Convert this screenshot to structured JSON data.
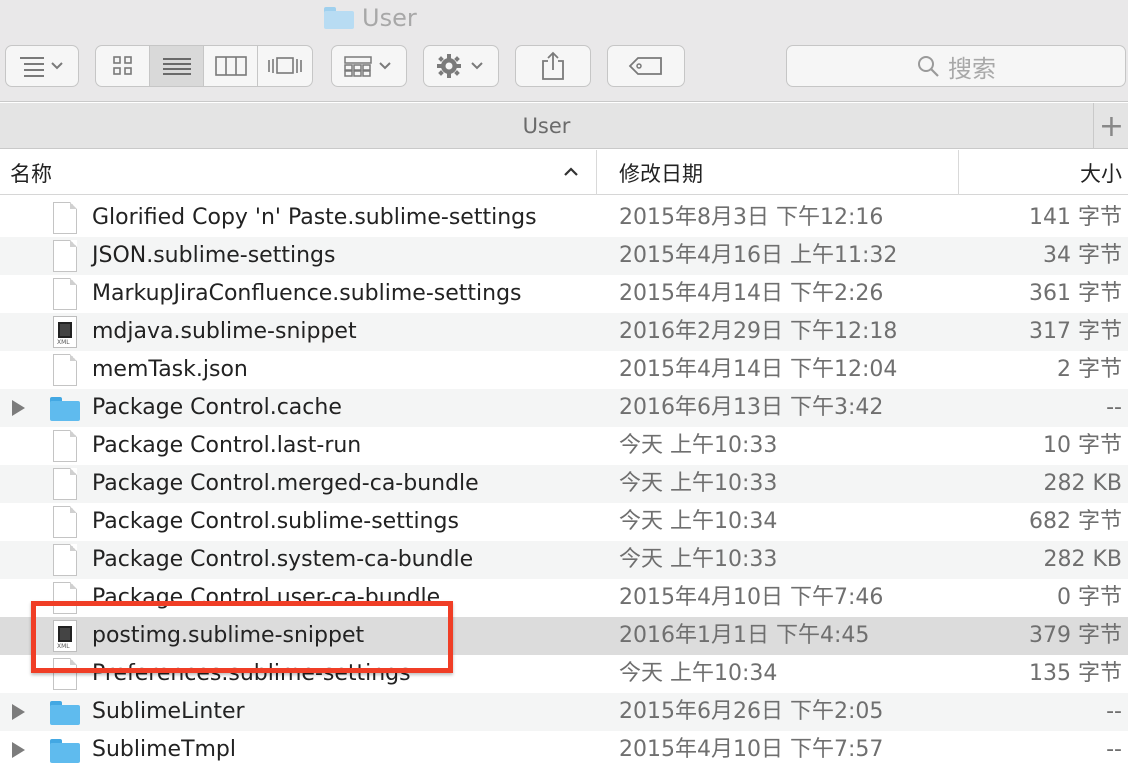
{
  "window": {
    "title": "User"
  },
  "toolbar": {
    "search_placeholder": "搜索"
  },
  "pathbar": {
    "current": "User",
    "add_tab": "+"
  },
  "columns": {
    "name": "名称",
    "date": "修改日期",
    "size": "大小"
  },
  "files": [
    {
      "name": "Glorified Copy 'n' Paste.sublime-settings",
      "date": "2015年8月3日 下午12:16",
      "size": "141 字节",
      "kind": "doc",
      "expandable": false,
      "selected": false
    },
    {
      "name": "JSON.sublime-settings",
      "date": "2015年4月16日 上午11:32",
      "size": "34 字节",
      "kind": "doc",
      "expandable": false,
      "selected": false
    },
    {
      "name": "MarkupJiraConfluence.sublime-settings",
      "date": "2015年4月14日 下午2:26",
      "size": "361 字节",
      "kind": "doc",
      "expandable": false,
      "selected": false
    },
    {
      "name": "mdjava.sublime-snippet",
      "date": "2016年2月29日 下午12:18",
      "size": "317 字节",
      "kind": "snippet",
      "expandable": false,
      "selected": false
    },
    {
      "name": "memTask.json",
      "date": "2015年4月14日 下午12:04",
      "size": "2 字节",
      "kind": "doc",
      "expandable": false,
      "selected": false
    },
    {
      "name": "Package Control.cache",
      "date": "2016年6月13日 下午3:42",
      "size": "--",
      "kind": "folder",
      "expandable": true,
      "selected": false
    },
    {
      "name": "Package Control.last-run",
      "date": "今天 上午10:33",
      "size": "10 字节",
      "kind": "doc",
      "expandable": false,
      "selected": false
    },
    {
      "name": "Package Control.merged-ca-bundle",
      "date": "今天 上午10:33",
      "size": "282 KB",
      "kind": "doc",
      "expandable": false,
      "selected": false
    },
    {
      "name": "Package Control.sublime-settings",
      "date": "今天 上午10:34",
      "size": "682 字节",
      "kind": "doc",
      "expandable": false,
      "selected": false
    },
    {
      "name": "Package Control.system-ca-bundle",
      "date": "今天 上午10:33",
      "size": "282 KB",
      "kind": "doc",
      "expandable": false,
      "selected": false
    },
    {
      "name": "Package Control.user-ca-bundle",
      "date": "2015年4月10日 下午7:46",
      "size": "0 字节",
      "kind": "doc",
      "expandable": false,
      "selected": false
    },
    {
      "name": "postimg.sublime-snippet",
      "date": "2016年1月1日 下午4:45",
      "size": "379 字节",
      "kind": "snippet",
      "expandable": false,
      "selected": true
    },
    {
      "name": "Preferences.sublime-settings",
      "date": "今天 上午10:34",
      "size": "135 字节",
      "kind": "doc",
      "expandable": false,
      "selected": false
    },
    {
      "name": "SublimeLinter",
      "date": "2015年6月26日 下午2:05",
      "size": "--",
      "kind": "folder",
      "expandable": true,
      "selected": false
    },
    {
      "name": "SublimeTmpl",
      "date": "2015年4月10日 下午7:57",
      "size": "--",
      "kind": "folder",
      "expandable": true,
      "selected": false
    }
  ],
  "annotation": {
    "color": "#f03e26",
    "target": "postimg.sublime-snippet"
  }
}
